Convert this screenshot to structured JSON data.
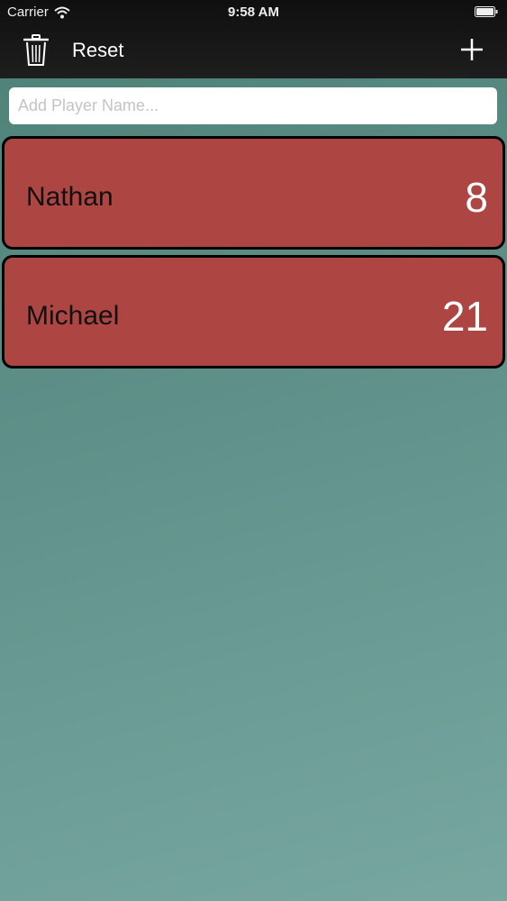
{
  "status_bar": {
    "carrier": "Carrier",
    "time": "9:58 AM"
  },
  "toolbar": {
    "trash_icon": "trash-icon",
    "reset_label": "Reset",
    "add_icon": "plus-icon"
  },
  "add_player": {
    "placeholder": "Add Player Name...",
    "value": ""
  },
  "players": [
    {
      "name": "Nathan",
      "score": "8"
    },
    {
      "name": "Michael",
      "score": "21"
    }
  ],
  "colors": {
    "card": "#ad4543",
    "card_border": "#000000",
    "background_top": "#4d8075",
    "background_bottom": "#77a7a0",
    "bar": "#1a1a1a"
  }
}
